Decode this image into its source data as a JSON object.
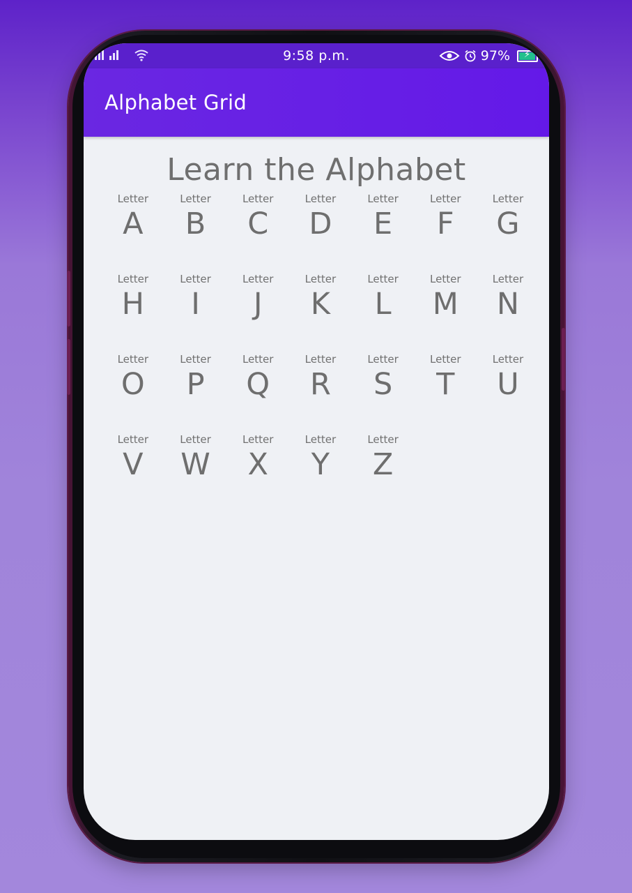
{
  "status_bar": {
    "time": "9:58 p.m.",
    "battery": "97%",
    "icons": [
      "signal-icon",
      "signal-icon",
      "wifi-icon",
      "eye-icon",
      "alarm-icon",
      "battery-charging-icon"
    ]
  },
  "app_bar": {
    "title": "Alphabet Grid"
  },
  "main": {
    "heading": "Learn the Alphabet",
    "caption": "Letter",
    "letters": [
      "A",
      "B",
      "C",
      "D",
      "E",
      "F",
      "G",
      "H",
      "I",
      "J",
      "K",
      "L",
      "M",
      "N",
      "O",
      "P",
      "Q",
      "R",
      "S",
      "T",
      "U",
      "V",
      "W",
      "X",
      "Y",
      "Z"
    ]
  },
  "colors": {
    "app_bar": "#6419e8",
    "status_bar": "#5a20cc",
    "screen_bg": "#eff1f5",
    "letter_text": "#6e6e6e"
  }
}
